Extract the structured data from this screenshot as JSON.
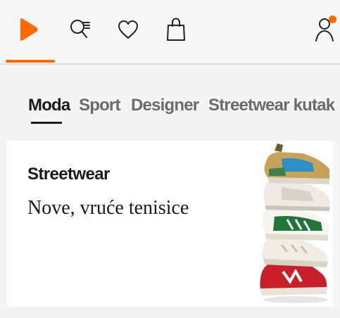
{
  "nav": {
    "items": [
      {
        "name": "home",
        "icon": "home-play-icon",
        "active": true
      },
      {
        "name": "search",
        "icon": "search-icon"
      },
      {
        "name": "favorites",
        "icon": "heart-icon"
      },
      {
        "name": "bag",
        "icon": "shopping-bag-icon"
      },
      {
        "name": "account",
        "icon": "user-icon",
        "has_notification": true
      }
    ],
    "accent_color": "#ff6900"
  },
  "tabs": {
    "items": [
      {
        "label": "Moda",
        "active": true
      },
      {
        "label": "Sport",
        "active": false
      },
      {
        "label": "Designer",
        "active": false
      },
      {
        "label": "Streetwear kutak",
        "active": false
      }
    ]
  },
  "banner": {
    "title": "Streetwear",
    "subtitle": "Nove, vruće tenisice",
    "image": "stacked-sneakers-image"
  }
}
